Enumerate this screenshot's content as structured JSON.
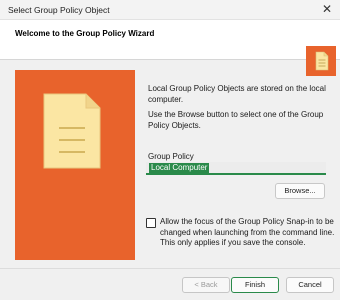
{
  "window": {
    "title": "Select Group Policy Object"
  },
  "header": {
    "heading": "Welcome to the Group Policy Wizard"
  },
  "body": {
    "intro": "Local Group Policy Objects are stored on the local computer.",
    "browse_hint": "Use the Browse button to select one of the Group Policy Objects.",
    "group_policy_label": "Group Policy",
    "group_policy_value": "Local Computer",
    "browse_label": "Browse...",
    "checkbox_label": "Allow the focus of the Group Policy Snap-in to be changed when launching from the command line. This only applies if you save the console.",
    "checkbox_checked": false
  },
  "footer": {
    "back_label": "< Back",
    "finish_label": "Finish",
    "cancel_label": "Cancel"
  },
  "colors": {
    "accent_orange": "#e8632c",
    "accent_green": "#2a8a4a",
    "document_fill": "#fbe6a3"
  },
  "icons": {
    "close": "close-icon",
    "document": "document-icon"
  }
}
